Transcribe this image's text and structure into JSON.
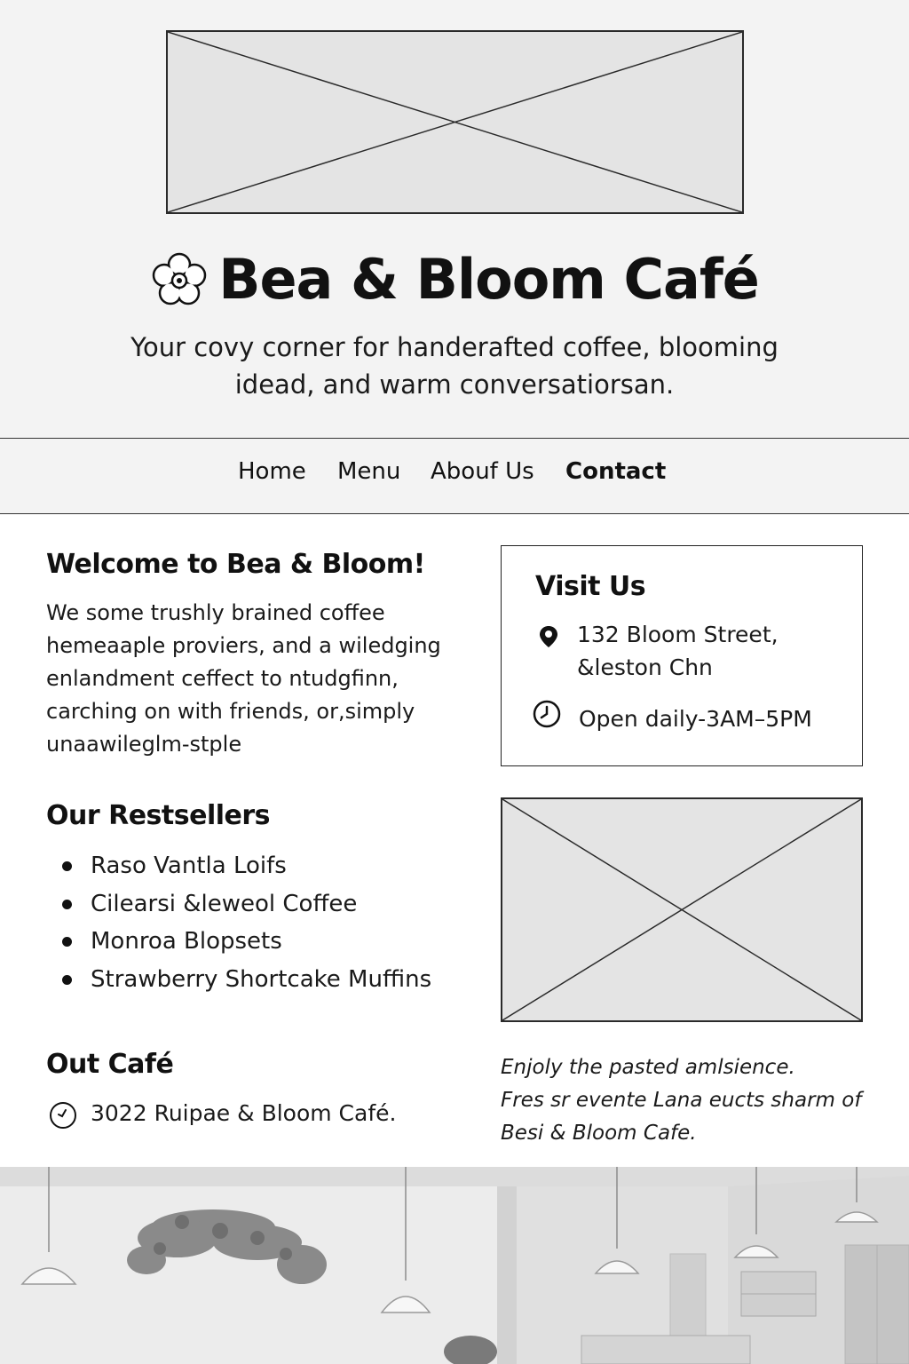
{
  "header": {
    "title": "Bea & Bloom Café",
    "logo_icon": "flower-icon",
    "tagline_line1": "Your covy corner for handerafted coffee, blooming",
    "tagline_line2": "idead, and warm conversatiorsan."
  },
  "nav": {
    "items": [
      "Home",
      "Menu",
      "Abouf Us",
      "Contact"
    ]
  },
  "welcome": {
    "heading": "Welcome to Bea & Bloom!",
    "lines": [
      "We some trushly brained coffee",
      "hemeaaple proviers, and a wiledging",
      "enlandment ceffect to ntudgfinn,",
      "carching on with friends, or,simply",
      "unaawileglm-stple"
    ]
  },
  "bestsellers": {
    "heading": "Our Restsellers",
    "items": [
      "Raso Vantla Loifs",
      "Cilearsi &leweol Coffee",
      "Monroa Blopsets",
      "Strawberry Shortcake Muffins"
    ]
  },
  "visit": {
    "heading": "Visit Us",
    "address_line1": "132 Bloom Street,",
    "address_line2": "&leston Chn",
    "hours": "Open daily-3AM–5PM",
    "location_icon": "location-pin-icon",
    "hours_icon": "clock-icon"
  },
  "cafe": {
    "heading": "Out Café",
    "line": "3022 Ruipae & Bloom Café.",
    "icon": "clock-icon"
  },
  "ambience": {
    "lines": [
      "Enjoly the pasted amlsience.",
      "Fres sr evente Lana eucts sharm of",
      "Besi & Bloom Cafe."
    ]
  },
  "colors": {
    "background": "#ffffff",
    "header_bg": "#f3f3f3",
    "placeholder_fill": "#e4e4e4",
    "text": "#141414",
    "border": "#222222"
  }
}
